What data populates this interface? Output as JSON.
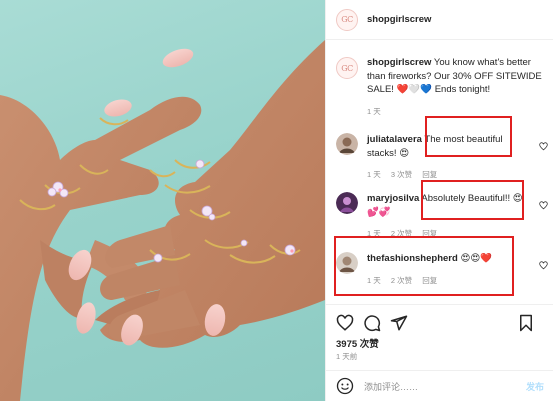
{
  "post": {
    "username": "shopgirlscrew",
    "avatar_initials": "GC",
    "caption_text": "You know what's better than fireworks? Our 30% OFF SITEWIDE SALE! ❤️🤍💙 Ends tonight!",
    "caption_time": "1 天"
  },
  "comments": [
    {
      "username": "juliatalavera",
      "text": "The most beautiful stacks! 😍",
      "time": "1 天",
      "likes": "3 次赞",
      "reply": "回复"
    },
    {
      "username": "maryjosilva",
      "text": "Absolutely Beautiful!! 😍💕💞",
      "time": "1 天",
      "likes": "2 次赞",
      "reply": "回复"
    },
    {
      "username": "thefashionshepherd",
      "text": "😍😍❤️",
      "time": "1 天",
      "likes": "2 次赞",
      "reply": "回复"
    }
  ],
  "engagement": {
    "likes": "3975 次赞",
    "posted": "1 天前"
  },
  "add_comment": {
    "placeholder": "添加评论……",
    "post_label": "发布"
  },
  "colors": {
    "highlight": "#e02020",
    "post_button_disabled": "#b2dffc",
    "photo_background": "#98d3cb"
  },
  "icons": [
    "heart-icon",
    "comment-icon",
    "share-icon",
    "bookmark-icon",
    "emoji-icon"
  ]
}
